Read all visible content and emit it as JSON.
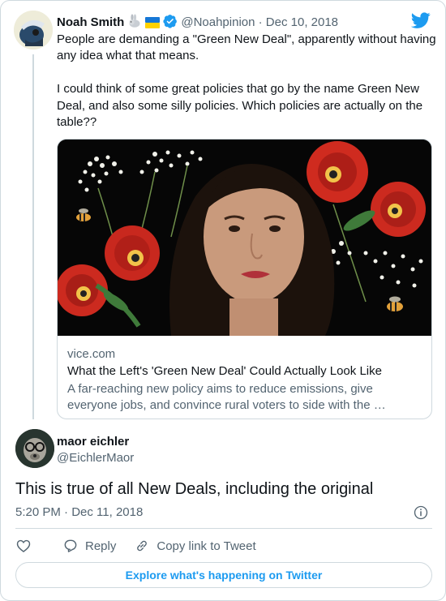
{
  "quoted_tweet": {
    "author_name": "Noah Smith",
    "author_emojis": [
      "rabbit-emoji",
      "ukraine-flag-emoji"
    ],
    "verified": true,
    "handle_and_date": "@Noahpinion · Dec 10, 2018",
    "paragraph_1": "People are demanding a \"Green New Deal\", apparently without having any idea what that means.",
    "paragraph_2": "I could think of some great policies that go by the name Green New Deal, and also some silly policies. Which policies are actually on the table??",
    "link_card": {
      "domain": "vice.com",
      "title": "What the Left's 'Green New Deal' Could Actually Look Like",
      "description": "A far-reaching new policy aims to reduce emissions, give everyone jobs, and convince rural voters to side with the …"
    }
  },
  "main_tweet": {
    "author_name": "maor eichler",
    "handle": "@EichlerMaor",
    "text": "This is true of all New Deals, including the original",
    "timestamp": "5:20 PM · Dec 11, 2018"
  },
  "actions": {
    "reply_label": "Reply",
    "copy_link_label": "Copy link to Tweet"
  },
  "explore_label": "Explore what's happening on Twitter",
  "colors": {
    "accent": "#1d9bf0",
    "text_primary": "#0f1419",
    "text_secondary": "#536471",
    "border": "#cfd9de"
  },
  "icons": [
    "twitter-bird-icon",
    "verified-badge-icon",
    "info-icon",
    "heart-icon",
    "reply-icon",
    "link-icon"
  ]
}
